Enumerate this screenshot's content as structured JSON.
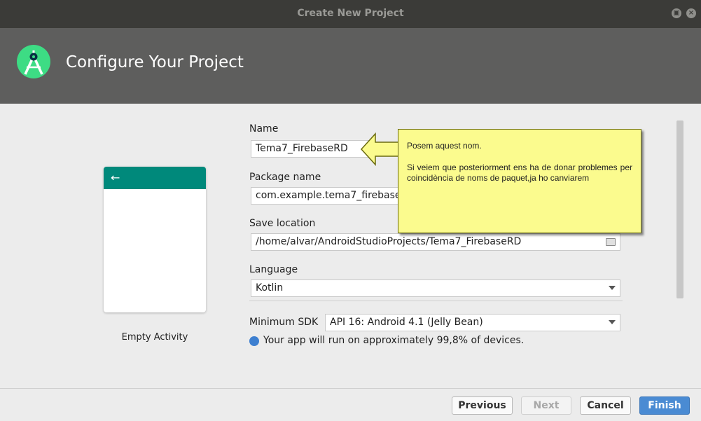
{
  "window": {
    "title": "Create New Project"
  },
  "header": {
    "title": "Configure Your Project"
  },
  "preview": {
    "template_name": "Empty Activity"
  },
  "form": {
    "name_label": "Name",
    "name_value": "Tema7_FirebaseRD",
    "package_label": "Package name",
    "package_value": "com.example.tema7_firebaserd",
    "location_label": "Save location",
    "location_value": "/home/alvar/AndroidStudioProjects/Tema7_FirebaseRD",
    "language_label": "Language",
    "language_value": "Kotlin",
    "sdk_label": "Minimum SDK",
    "sdk_value": "API 16: Android 4.1 (Jelly Bean)",
    "sdk_info": "Your app will run on approximately 99,8% of devices."
  },
  "callout": {
    "line1": "Posem aquest nom.",
    "line2": "Si veiem que posteriorment ens ha de donar problemes per coincidència de noms de paquet,ja ho canviarem"
  },
  "footer": {
    "previous": "Previous",
    "next": "Next",
    "cancel": "Cancel",
    "finish": "Finish"
  },
  "colors": {
    "accent": "#4a8bd3",
    "app_bar": "#00897b",
    "callout_bg": "#fbfb8e"
  }
}
